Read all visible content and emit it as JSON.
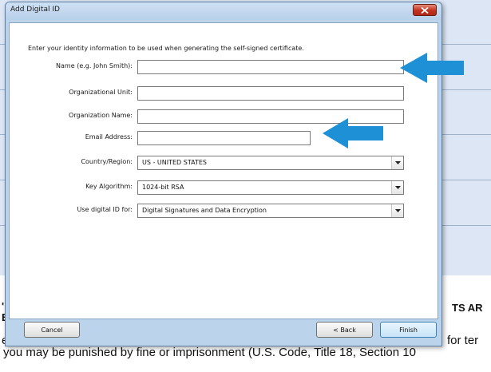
{
  "background": {
    "bold_left": "'I",
    "bold_left_2": "E",
    "bold_right": "TS AR",
    "line_left": "e",
    "line_right": "for ter",
    "line_full": "you may be punished by fine or imprisonment (U.S. Code, Title 18, Section 10"
  },
  "dialog": {
    "title": "Add Digital ID",
    "intro": "Enter your identity information to be used when generating the self-signed certificate.",
    "fields": {
      "name_label": "Name (e.g. John Smith):",
      "name_value": "",
      "org_unit_label": "Organizational Unit:",
      "org_unit_value": "",
      "org_name_label": "Organization Name:",
      "org_name_value": "",
      "email_label": "Email Address:",
      "email_value": "",
      "country_label": "Country/Region:",
      "country_value": "US - UNITED STATES",
      "key_label": "Key Algorithm:",
      "key_value": "1024-bit RSA",
      "use_label": "Use digital ID for:",
      "use_value": "Digital Signatures and Data Encryption"
    },
    "buttons": {
      "cancel": "Cancel",
      "back": "< Back",
      "finish": "Finish"
    }
  },
  "colors": {
    "arrow": "#1e90d6",
    "titlebar": "#bcd3ec",
    "close": "#c2331e"
  },
  "icons": {
    "close": "close-icon",
    "dropdown": "chevron-down-icon",
    "arrow": "left-arrow-icon"
  }
}
